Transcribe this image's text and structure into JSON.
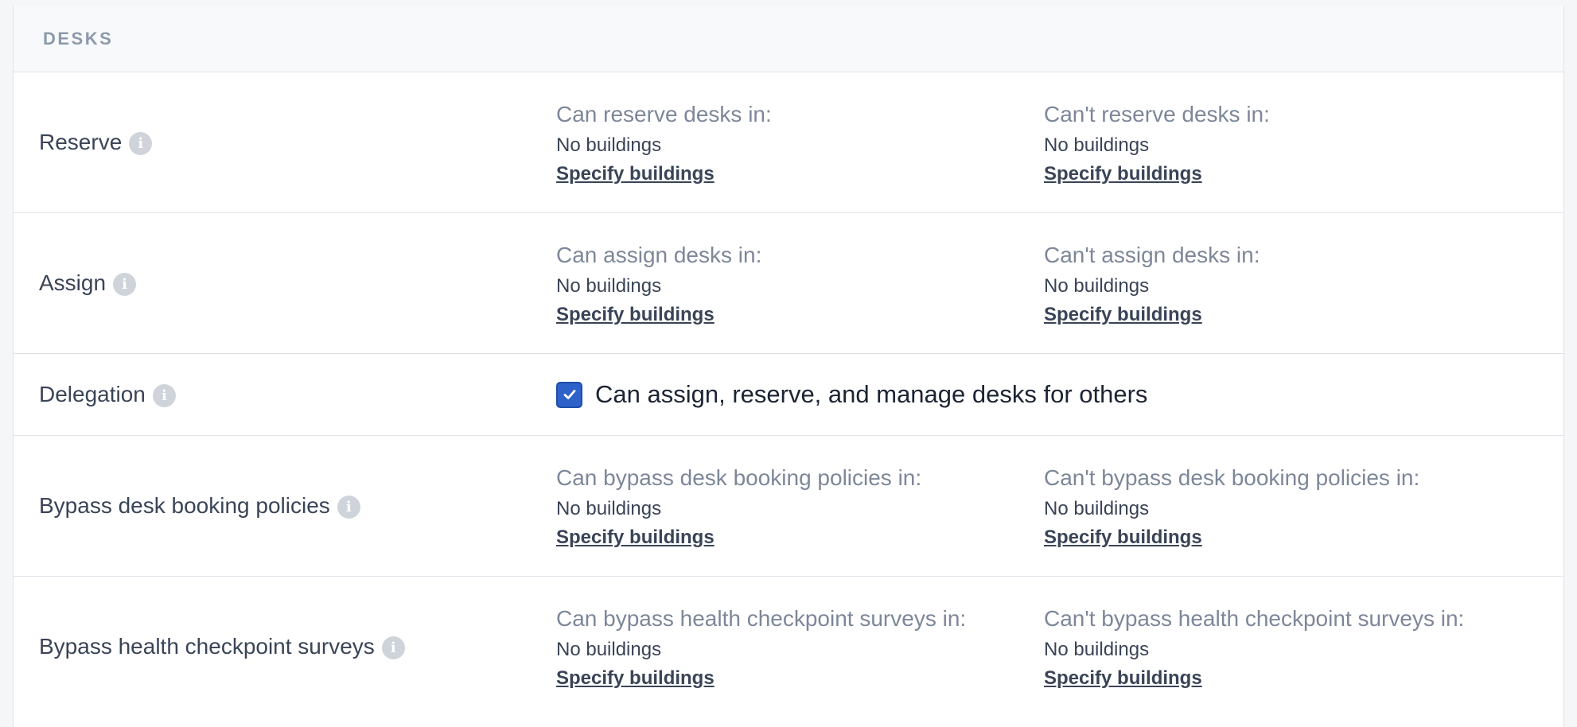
{
  "section": {
    "title": "DESKS"
  },
  "rows": [
    {
      "label": "Reserve",
      "can_heading": "Can reserve desks in:",
      "can_value": "No buildings",
      "can_link": "Specify buildings",
      "cant_heading": "Can't reserve desks in:",
      "cant_value": "No buildings",
      "cant_link": "Specify buildings"
    },
    {
      "label": "Assign",
      "can_heading": "Can assign desks in:",
      "can_value": "No buildings",
      "can_link": "Specify buildings",
      "cant_heading": "Can't assign desks in:",
      "cant_value": "No buildings",
      "cant_link": "Specify buildings"
    },
    {
      "label": "Delegation",
      "checkbox_label": "Can assign, reserve, and manage desks for others",
      "checked": true
    },
    {
      "label": "Bypass desk booking policies",
      "can_heading": "Can bypass desk booking policies in:",
      "can_value": "No buildings",
      "can_link": "Specify buildings",
      "cant_heading": "Can't bypass desk booking policies in:",
      "cant_value": "No buildings",
      "cant_link": "Specify buildings"
    },
    {
      "label": "Bypass health checkpoint surveys",
      "can_heading": "Can bypass health checkpoint surveys in:",
      "can_value": "No buildings",
      "can_link": "Specify buildings",
      "cant_heading": "Can't bypass health checkpoint surveys in:",
      "cant_value": "No buildings",
      "cant_link": "Specify buildings"
    }
  ],
  "icons": {
    "info": "info-icon",
    "checkbox_check": "checkmark-icon"
  },
  "colors": {
    "checkbox": "#2f62c9",
    "heading_text": "#7d8799",
    "body_text": "#3a4457",
    "section_title": "#8d99ab"
  }
}
